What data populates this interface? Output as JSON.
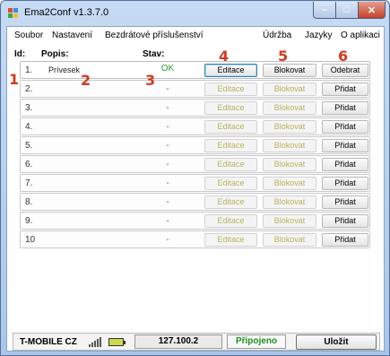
{
  "window": {
    "title": "Ema2Conf v1.3.7.0",
    "app_icon": "app-icon"
  },
  "menu": {
    "items": [
      "Soubor",
      "Nastavení",
      "Bezdrátové příslušenství",
      "Údržba",
      "Jazyky",
      "O aplikaci"
    ]
  },
  "headers": {
    "id": "Id:",
    "description": "Popis:",
    "state": "Stav:"
  },
  "rows": [
    {
      "id": "1.",
      "description": "Prívesek",
      "state": "OK",
      "edit": "Editace",
      "block": "Blokovat",
      "action": "Odebrat",
      "enabled": true
    },
    {
      "id": "2.",
      "description": "",
      "state": "-",
      "edit": "Editace",
      "block": "Blokovat",
      "action": "Přidat",
      "enabled": false
    },
    {
      "id": "3.",
      "description": "",
      "state": "-",
      "edit": "Editace",
      "block": "Blokovat",
      "action": "Přidat",
      "enabled": false
    },
    {
      "id": "4.",
      "description": "",
      "state": "-",
      "edit": "Editace",
      "block": "Blokovat",
      "action": "Přidat",
      "enabled": false
    },
    {
      "id": "5.",
      "description": "",
      "state": "-",
      "edit": "Editace",
      "block": "Blokovat",
      "action": "Přidat",
      "enabled": false
    },
    {
      "id": "6.",
      "description": "",
      "state": "-",
      "edit": "Editace",
      "block": "Blokovat",
      "action": "Přidat",
      "enabled": false
    },
    {
      "id": "7.",
      "description": "",
      "state": "-",
      "edit": "Editace",
      "block": "Blokovat",
      "action": "Přidat",
      "enabled": false
    },
    {
      "id": "8.",
      "description": "",
      "state": "-",
      "edit": "Editace",
      "block": "Blokovat",
      "action": "Přidat",
      "enabled": false
    },
    {
      "id": "9.",
      "description": "",
      "state": "-",
      "edit": "Editace",
      "block": "Blokovat",
      "action": "Přidat",
      "enabled": false
    },
    {
      "id": "10",
      "description": "",
      "state": "-",
      "edit": "Editace",
      "block": "Blokovat",
      "action": "Přidat",
      "enabled": false
    }
  ],
  "markers": [
    "1",
    "2",
    "3",
    "4",
    "5",
    "6"
  ],
  "status": {
    "operator": "T-MOBILE CZ",
    "signal_icon": "signal-strength-icon",
    "battery_icon": "battery-icon",
    "ip": "127.100.2",
    "connection": "Připojeno",
    "save": "Uložit"
  },
  "colors": {
    "ok": "#2f9a2f",
    "marker": "#d43a20",
    "disabled_text": "#b7b35b"
  }
}
